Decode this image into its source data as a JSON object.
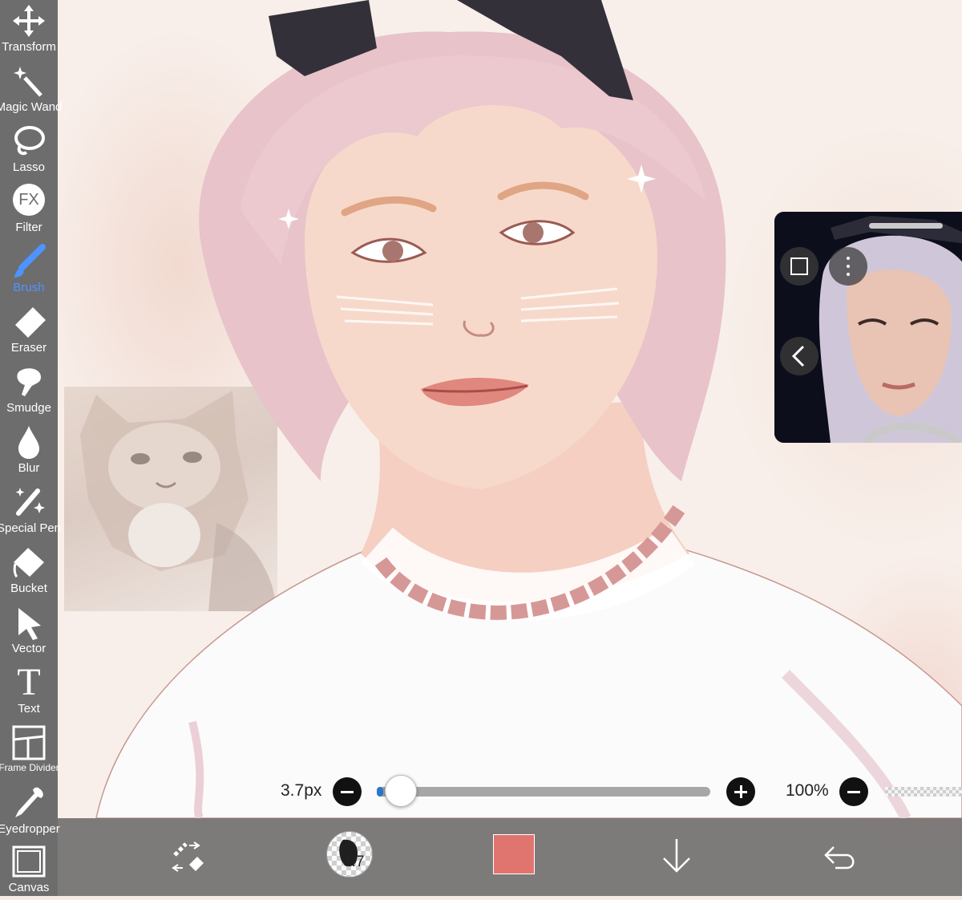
{
  "toolbar": {
    "tools": [
      {
        "label": "Transform",
        "icon": "move-arrows-icon"
      },
      {
        "label": "Magic Wand",
        "icon": "magic-wand-icon"
      },
      {
        "label": "Lasso",
        "icon": "lasso-icon"
      },
      {
        "label": "Filter",
        "icon": "fx-icon",
        "glyph": "FX"
      },
      {
        "label": "Brush",
        "icon": "brush-icon",
        "active": true
      },
      {
        "label": "Eraser",
        "icon": "eraser-icon"
      },
      {
        "label": "Smudge",
        "icon": "smudge-icon"
      },
      {
        "label": "Blur",
        "icon": "blur-drop-icon"
      },
      {
        "label": "Special Pen",
        "icon": "special-pen-icon"
      },
      {
        "label": "Bucket",
        "icon": "bucket-icon"
      },
      {
        "label": "Vector",
        "icon": "vector-arrow-icon"
      },
      {
        "label": "Text",
        "icon": "text-icon",
        "glyph": "T"
      },
      {
        "label": "Frame Divider",
        "icon": "frame-divider-icon"
      },
      {
        "label": "Eyedropper",
        "icon": "eyedropper-icon"
      },
      {
        "label": "Canvas",
        "icon": "canvas-icon"
      }
    ],
    "active_color": "#4d94ff"
  },
  "brush_size": {
    "label": "3.7px",
    "slider_fraction": 0.02
  },
  "opacity": {
    "label": "100%"
  },
  "bottom_bar": {
    "brush_thumbnail_value": "3.7",
    "current_color": "#e07570",
    "icons": [
      "swap-brush-eraser-icon",
      "brush-thumbnail",
      "color-swatch",
      "layer-down-arrow-icon",
      "undo-icon"
    ]
  },
  "pip": {
    "buttons": [
      "stop-square-icon",
      "more-dots-icon",
      "back-chevron-icon"
    ]
  }
}
